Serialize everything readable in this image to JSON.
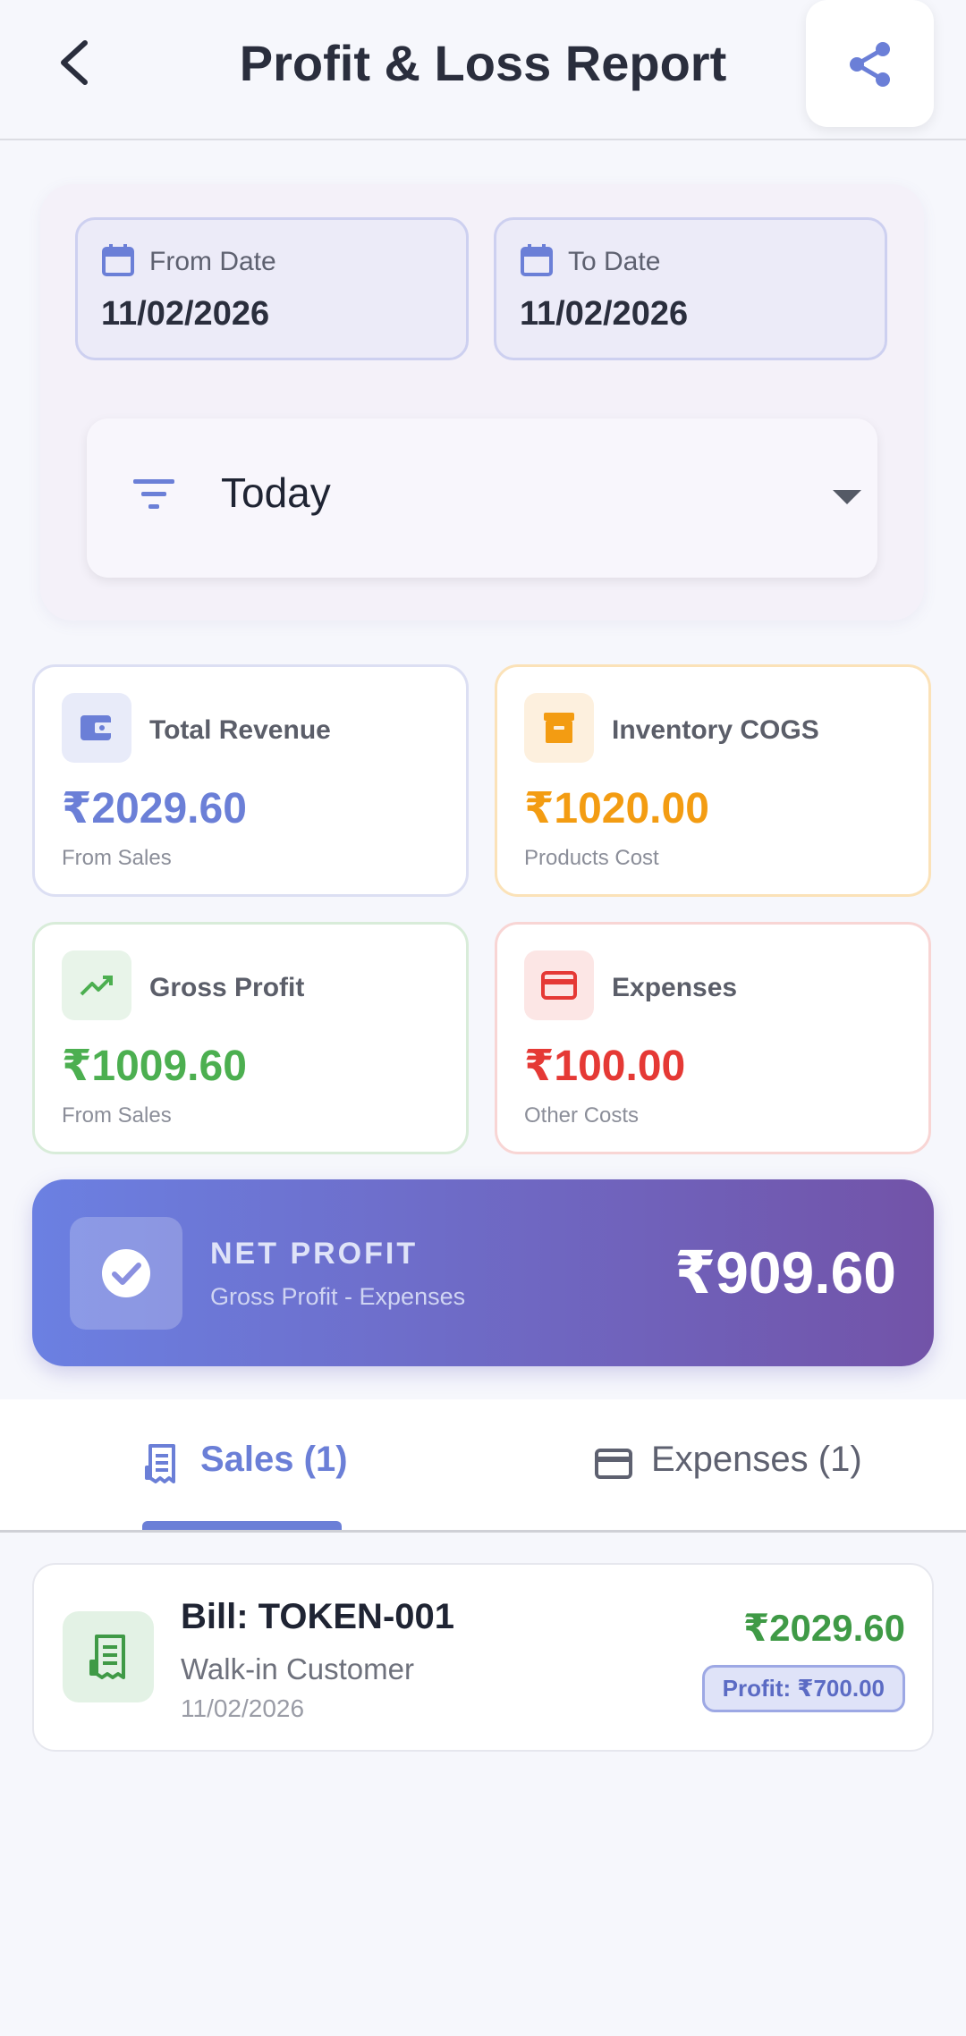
{
  "header": {
    "title": "Profit & Loss Report",
    "back_icon": "arrow-back-icon",
    "share_icon": "share-icon"
  },
  "filters": {
    "from_date": {
      "label": "From Date",
      "value": "11/02/2026"
    },
    "to_date": {
      "label": "To Date",
      "value": "11/02/2026"
    },
    "period": {
      "selected": "Today"
    }
  },
  "stats": {
    "revenue": {
      "label": "Total Revenue",
      "value": "₹2029.60",
      "sub": "From Sales",
      "color": "#6b7fd7"
    },
    "cogs": {
      "label": "Inventory COGS",
      "value": "₹1020.00",
      "sub": "Products Cost",
      "color": "#f39c12"
    },
    "gross": {
      "label": "Gross Profit",
      "value": "₹1009.60",
      "sub": "From Sales",
      "color": "#4caf50"
    },
    "expenses": {
      "label": "Expenses",
      "value": "₹100.00",
      "sub": "Other Costs",
      "color": "#e53935"
    }
  },
  "net_profit": {
    "label": "NET PROFIT",
    "sub": "Gross Profit - Expenses",
    "value": "₹909.60"
  },
  "tabs": {
    "sales": "Sales (1)",
    "expenses": "Expenses (1)",
    "active": "sales"
  },
  "sales": [
    {
      "bill": "Bill: TOKEN-001",
      "customer": "Walk-in Customer",
      "date": "11/02/2026",
      "amount": "₹2029.60",
      "profit": "Profit: ₹700.00"
    }
  ]
}
